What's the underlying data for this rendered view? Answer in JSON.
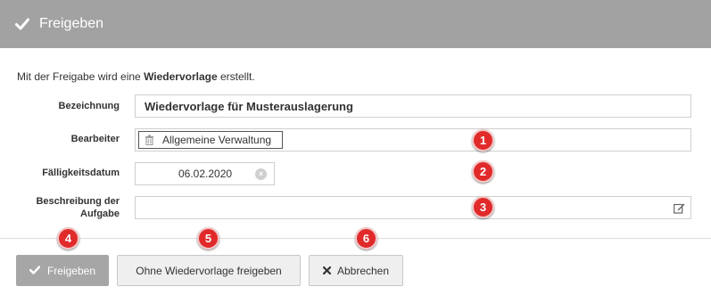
{
  "header": {
    "title": "Freigeben",
    "icon": "check-icon",
    "bg": "#a2a2a2"
  },
  "intro": {
    "prefix": "Mit der Freigabe wird eine ",
    "bold": "Wiedervorlage",
    "suffix": " erstellt."
  },
  "form": {
    "bezeichnung": {
      "label": "Bezeichnung",
      "value": "Wiedervorlage für Musterauslagerung"
    },
    "bearbeiter": {
      "label": "Bearbeiter",
      "tag": "Allgemeine Verwaltung"
    },
    "faelligkeit": {
      "label": "Fälligkeitsdatum",
      "value": "06.02.2020"
    },
    "beschreibung": {
      "label_line1": "Beschreibung der",
      "label_line2": "Aufgabe",
      "value": ""
    }
  },
  "buttons": {
    "freigeben": "Freigeben",
    "ohne": "Ohne Wiedervorlage freigeben",
    "abbrechen": "Abbrechen"
  },
  "markers": [
    "1",
    "2",
    "3",
    "4",
    "5",
    "6"
  ],
  "colors": {
    "marker": "#e12a2a",
    "primary_button": "#a6a6a6"
  }
}
